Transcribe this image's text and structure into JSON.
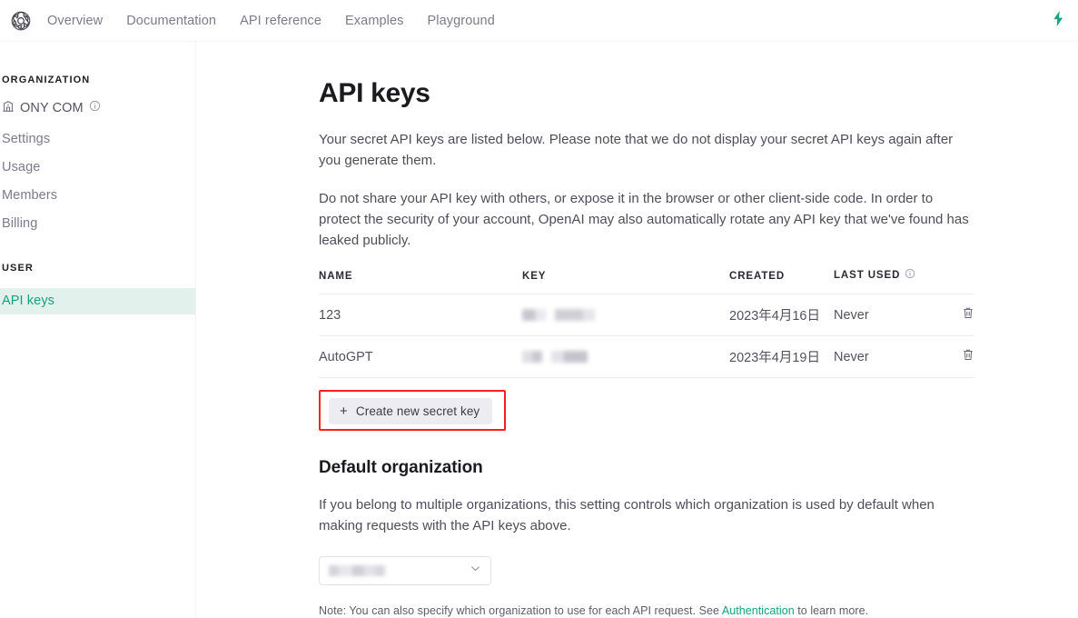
{
  "topnav": {
    "logo_icon": "openai-logo-icon",
    "links": [
      {
        "label": "Overview"
      },
      {
        "label": "Documentation"
      },
      {
        "label": "API reference"
      },
      {
        "label": "Examples"
      },
      {
        "label": "Playground"
      }
    ],
    "upgrade_icon": "lightning-bolt-icon"
  },
  "sidebar": {
    "org_heading": "ORGANIZATION",
    "org_icon": "building-icon",
    "org_name": "ONY COM",
    "org_info_icon": "info-icon",
    "org_items": [
      {
        "label": "Settings"
      },
      {
        "label": "Usage"
      },
      {
        "label": "Members"
      },
      {
        "label": "Billing"
      }
    ],
    "user_heading": "USER",
    "user_items": [
      {
        "label": "API keys",
        "active": true
      }
    ],
    "active_bg": "#e3f1ec",
    "active_color": "#11a37f"
  },
  "main": {
    "title": "API keys",
    "paragraph_1": "Your secret API keys are listed below. Please note that we do not display your secret API keys again after you generate them.",
    "paragraph_2": "Do not share your API key with others, or expose it in the browser or other client-side code. In order to protect the security of your account, OpenAI may also automatically rotate any API key that we've found has leaked publicly.",
    "table": {
      "headers": {
        "name": "NAME",
        "key": "KEY",
        "created": "CREATED",
        "last_used": "LAST USED",
        "last_used_info_icon": "info-icon"
      },
      "rows": [
        {
          "name": "123",
          "key": "",
          "key_redacted": true,
          "created": "2023年4月16日",
          "last_used": "Never",
          "delete_icon": "trash-icon"
        },
        {
          "name": "AutoGPT",
          "key": "",
          "key_redacted": true,
          "created": "2023年4月19日",
          "last_used": "Never",
          "delete_icon": "trash-icon"
        }
      ]
    },
    "create_button": {
      "label": "Create new secret key",
      "plus_icon": "plus-icon",
      "highlight_color": "#fb1e1e"
    },
    "default_org": {
      "title": "Default organization",
      "description": "If you belong to multiple organizations, this setting controls which organization is used by default when making requests with the API keys above.",
      "select_value": "",
      "select_redacted": true,
      "chevron_icon": "chevron-down-icon",
      "note_prefix": "Note: You can also specify which organization to use for each API request. See ",
      "note_link": "Authentication",
      "note_suffix": " to learn more."
    }
  }
}
